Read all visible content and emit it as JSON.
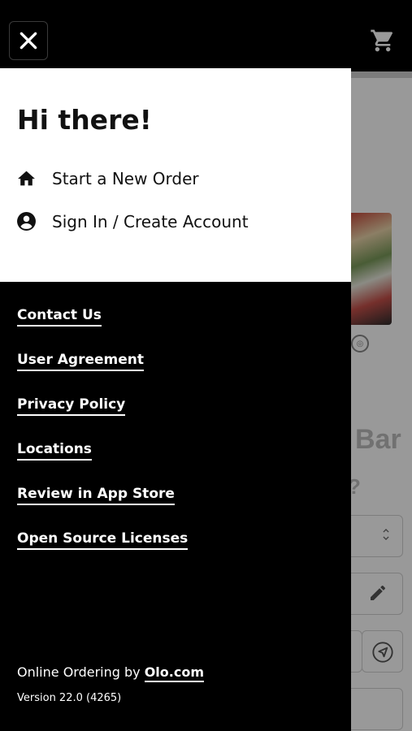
{
  "drawer": {
    "greeting": "Hi there!",
    "menu": [
      {
        "label": "Start a New Order",
        "icon": "home-icon"
      },
      {
        "label": "Sign In / Create Account",
        "icon": "account-circle-icon"
      }
    ],
    "links": [
      {
        "label": "Contact Us"
      },
      {
        "label": "User Agreement"
      },
      {
        "label": "Privacy Policy"
      },
      {
        "label": "Locations"
      },
      {
        "label": "Review in App Store"
      },
      {
        "label": "Open Source Licenses"
      }
    ],
    "footer": {
      "prefix": "Online Ordering by ",
      "link": "Olo.com",
      "version": "Version 22.0 (4265)"
    }
  },
  "background": {
    "title_fragment": "Bar",
    "question_fragment": "?"
  },
  "colors": {
    "drawer_background": "#000000",
    "panel_background": "#ffffff",
    "text_dark": "#111111",
    "text_light": "#ffffff"
  }
}
